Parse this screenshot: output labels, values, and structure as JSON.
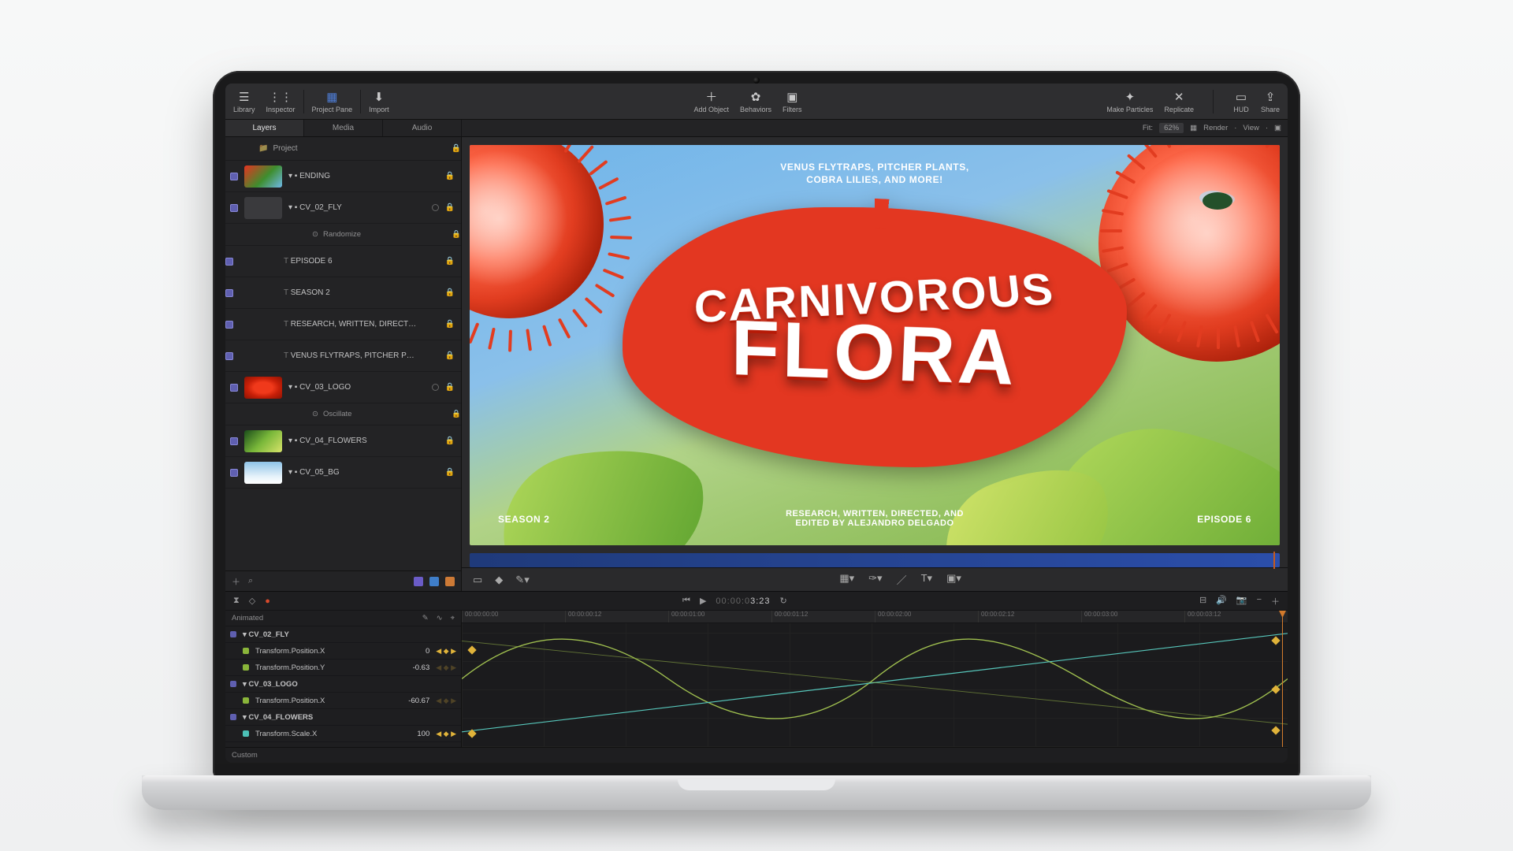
{
  "toolbar": {
    "left": [
      {
        "id": "library",
        "label": "Library",
        "glyph": "☰"
      },
      {
        "id": "inspector",
        "label": "Inspector",
        "glyph": "⋮⋮"
      }
    ],
    "project_pane": {
      "label": "Project Pane",
      "glyph": "▦"
    },
    "import": {
      "label": "Import",
      "glyph": "⬇"
    },
    "center": [
      {
        "id": "add-object",
        "label": "Add Object",
        "glyph": "＋"
      },
      {
        "id": "behaviors",
        "label": "Behaviors",
        "glyph": "✿"
      },
      {
        "id": "filters",
        "label": "Filters",
        "glyph": "▣"
      }
    ],
    "right": [
      {
        "id": "make-particles",
        "label": "Make Particles",
        "glyph": "✦"
      },
      {
        "id": "replicate",
        "label": "Replicate",
        "glyph": "✕"
      },
      {
        "id": "hud",
        "label": "HUD",
        "glyph": "▭"
      },
      {
        "id": "share",
        "label": "Share",
        "glyph": "⇪"
      }
    ]
  },
  "tabs": {
    "items": [
      "Layers",
      "Media",
      "Audio"
    ],
    "active": 0
  },
  "viewer_bar": {
    "fit_label": "Fit:",
    "fit_value": "62%",
    "items": [
      "Render",
      "View"
    ]
  },
  "sidebar": {
    "project_label": "Project",
    "layers": [
      {
        "kind": "group",
        "name": "ENDING",
        "thumb": "hero"
      },
      {
        "kind": "group",
        "name": "CV_02_FLY",
        "thumb": "plain",
        "show_bullet": true
      },
      {
        "kind": "effect",
        "name": "Randomize"
      },
      {
        "kind": "text",
        "name": "EPISODE 6",
        "thumb_label": "EPISODE 6"
      },
      {
        "kind": "text",
        "name": "SEASON 2",
        "thumb_label": "SEASON 2"
      },
      {
        "kind": "text",
        "name": "RESEARCH, WRITTEN, DIRECT…",
        "thumb_label": ""
      },
      {
        "kind": "text",
        "name": "VENUS FLYTRAPS, PITCHER P…",
        "thumb_label": ""
      },
      {
        "kind": "group",
        "name": "CV_03_LOGO",
        "thumb": "logo",
        "show_bullet": true
      },
      {
        "kind": "effect",
        "name": "Oscillate"
      },
      {
        "kind": "group",
        "name": "CV_04_FLOWERS",
        "thumb": "flowers"
      },
      {
        "kind": "group",
        "name": "CV_05_BG",
        "thumb": "bg"
      }
    ]
  },
  "canvas": {
    "tagline_l1": "VENUS FLYTRAPS, PITCHER PLANTS,",
    "tagline_l2": "COBRA LILIES, AND MORE!",
    "title_1": "CARNIVOROUS",
    "title_2": "FLORA",
    "credit_l1": "RESEARCH, WRITTEN, DIRECTED, AND",
    "credit_l2": "EDITED BY ALEJANDRO DELGADO",
    "season": "SEASON 2",
    "episode": "EPISODE 6"
  },
  "timeline": {
    "timecode_dim": "00:00:0",
    "timecode": "3:23",
    "animated_label": "Animated",
    "custom_label": "Custom",
    "ruler": [
      "00:00:00:00",
      "00:00:00:12",
      "00:00:01:00",
      "00:00:01:12",
      "00:00:02:00",
      "00:00:02:12",
      "00:00:03:00",
      "00:00:03:12"
    ],
    "params": [
      {
        "type": "grp",
        "name": "CV_02_FLY"
      },
      {
        "type": "p",
        "swatch": "g",
        "name": "Transform.Position.X",
        "val": "0",
        "kf": true
      },
      {
        "type": "p",
        "swatch": "g",
        "name": "Transform.Position.Y",
        "val": "-0.63"
      },
      {
        "type": "grp",
        "name": "CV_03_LOGO"
      },
      {
        "type": "p",
        "swatch": "g",
        "name": "Transform.Position.X",
        "val": "-60.67"
      },
      {
        "type": "grp",
        "name": "CV_04_FLOWERS"
      },
      {
        "type": "p",
        "swatch": "t",
        "name": "Transform.Scale.X",
        "val": "100",
        "kf": true
      }
    ]
  }
}
